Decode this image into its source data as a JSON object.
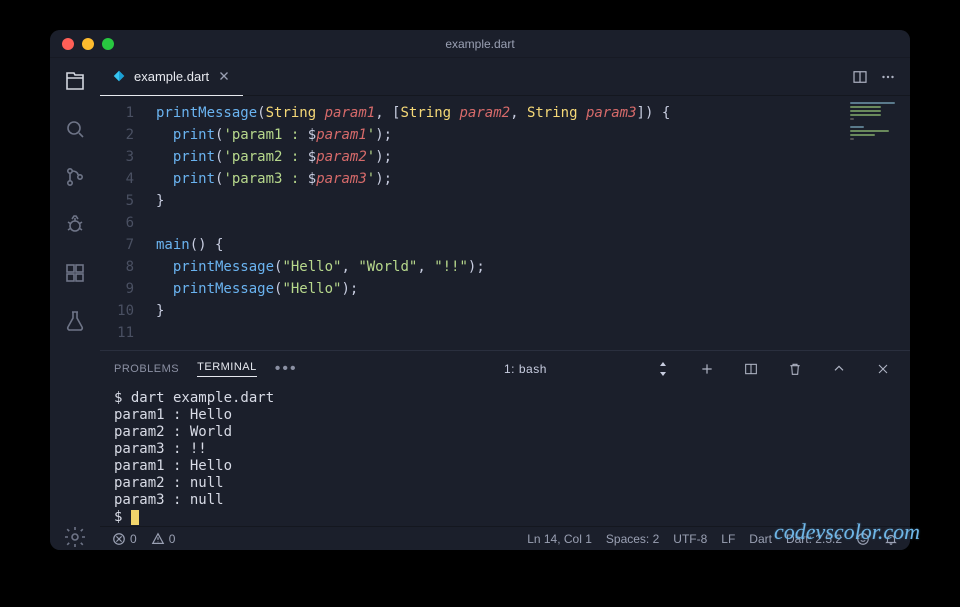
{
  "titlebar": {
    "title": "example.dart"
  },
  "tab": {
    "filename": "example.dart"
  },
  "code": {
    "lines": [
      {
        "n": "1",
        "html": "<span class='tok-func'>printMessage</span><span class='tok-punc'>(</span><span class='tok-type'>String</span> <span class='tok-param'>param1</span><span class='tok-punc'>, [</span><span class='tok-type'>String</span> <span class='tok-param'>param2</span><span class='tok-punc'>, </span><span class='tok-type'>String</span> <span class='tok-param'>param3</span><span class='tok-punc'>]) {</span>"
      },
      {
        "n": "2",
        "html": "  <span class='tok-func'>print</span><span class='tok-punc'>(</span><span class='tok-str'>'param1 : </span><span class='tok-punc'>$</span><span class='tok-param'>param1</span><span class='tok-str'>'</span><span class='tok-punc'>);</span>"
      },
      {
        "n": "3",
        "html": "  <span class='tok-func'>print</span><span class='tok-punc'>(</span><span class='tok-str'>'param2 : </span><span class='tok-punc'>$</span><span class='tok-param'>param2</span><span class='tok-str'>'</span><span class='tok-punc'>);</span>"
      },
      {
        "n": "4",
        "html": "  <span class='tok-func'>print</span><span class='tok-punc'>(</span><span class='tok-str'>'param3 : </span><span class='tok-punc'>$</span><span class='tok-param'>param3</span><span class='tok-str'>'</span><span class='tok-punc'>);</span>"
      },
      {
        "n": "5",
        "html": "<span class='tok-punc'>}</span>"
      },
      {
        "n": "6",
        "html": ""
      },
      {
        "n": "7",
        "html": "<span class='tok-func'>main</span><span class='tok-punc'>() {</span>"
      },
      {
        "n": "8",
        "html": "  <span class='tok-func'>printMessage</span><span class='tok-punc'>(</span><span class='tok-str'>\"Hello\"</span><span class='tok-punc'>, </span><span class='tok-str'>\"World\"</span><span class='tok-punc'>, </span><span class='tok-str'>\"!!\"</span><span class='tok-punc'>);</span>"
      },
      {
        "n": "9",
        "html": "  <span class='tok-func'>printMessage</span><span class='tok-punc'>(</span><span class='tok-str'>\"Hello\"</span><span class='tok-punc'>);</span>"
      },
      {
        "n": "10",
        "html": "<span class='tok-punc'>}</span>"
      },
      {
        "n": "11",
        "html": ""
      }
    ]
  },
  "panel": {
    "tabs": {
      "problems": "PROBLEMS",
      "terminal": "TERMINAL"
    },
    "terminal_selector": "1: bash"
  },
  "terminal": {
    "lines": [
      "$ dart example.dart",
      "param1 : Hello",
      "param2 : World",
      "param3 : !!",
      "param1 : Hello",
      "param2 : null",
      "param3 : null"
    ],
    "prompt": "$ "
  },
  "statusbar": {
    "errors": "0",
    "warnings": "0",
    "lncol": "Ln 14, Col 1",
    "spaces": "Spaces: 2",
    "encoding": "UTF-8",
    "eol": "LF",
    "lang": "Dart",
    "sdk": "Dart: 2.5.2"
  },
  "watermark": "codevscolor.com"
}
